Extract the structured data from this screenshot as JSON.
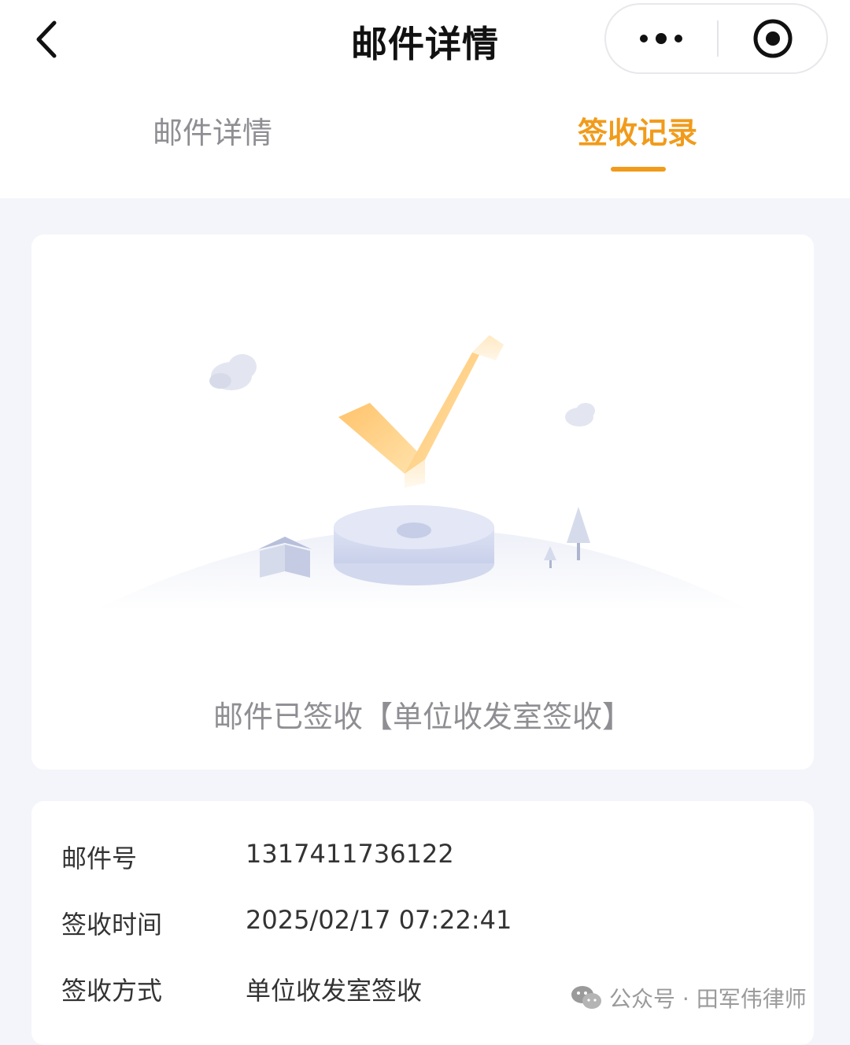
{
  "navbar": {
    "title": "邮件详情",
    "back_icon": "chevron-left-icon",
    "more_icon": "more-dots-icon",
    "target_icon": "target-icon"
  },
  "tabs": [
    {
      "label": "邮件详情",
      "active": false
    },
    {
      "label": "签收记录",
      "active": true
    }
  ],
  "colors": {
    "accent": "#f19b1b",
    "page_bg": "#f4f5fa",
    "muted_text": "#8e8e93"
  },
  "status": {
    "text": "邮件已签收【单位收发室签收】",
    "illustration": "checkmark-signed-illustration"
  },
  "details": [
    {
      "label": "邮件号",
      "value": "1317411736122"
    },
    {
      "label": "签收时间",
      "value": "2025/02/17 07:22:41"
    },
    {
      "label": "签收方式",
      "value": "单位收发室签收"
    }
  ],
  "watermark": {
    "icon": "wechat-icon",
    "text": "公众号 · 田军伟律师"
  }
}
